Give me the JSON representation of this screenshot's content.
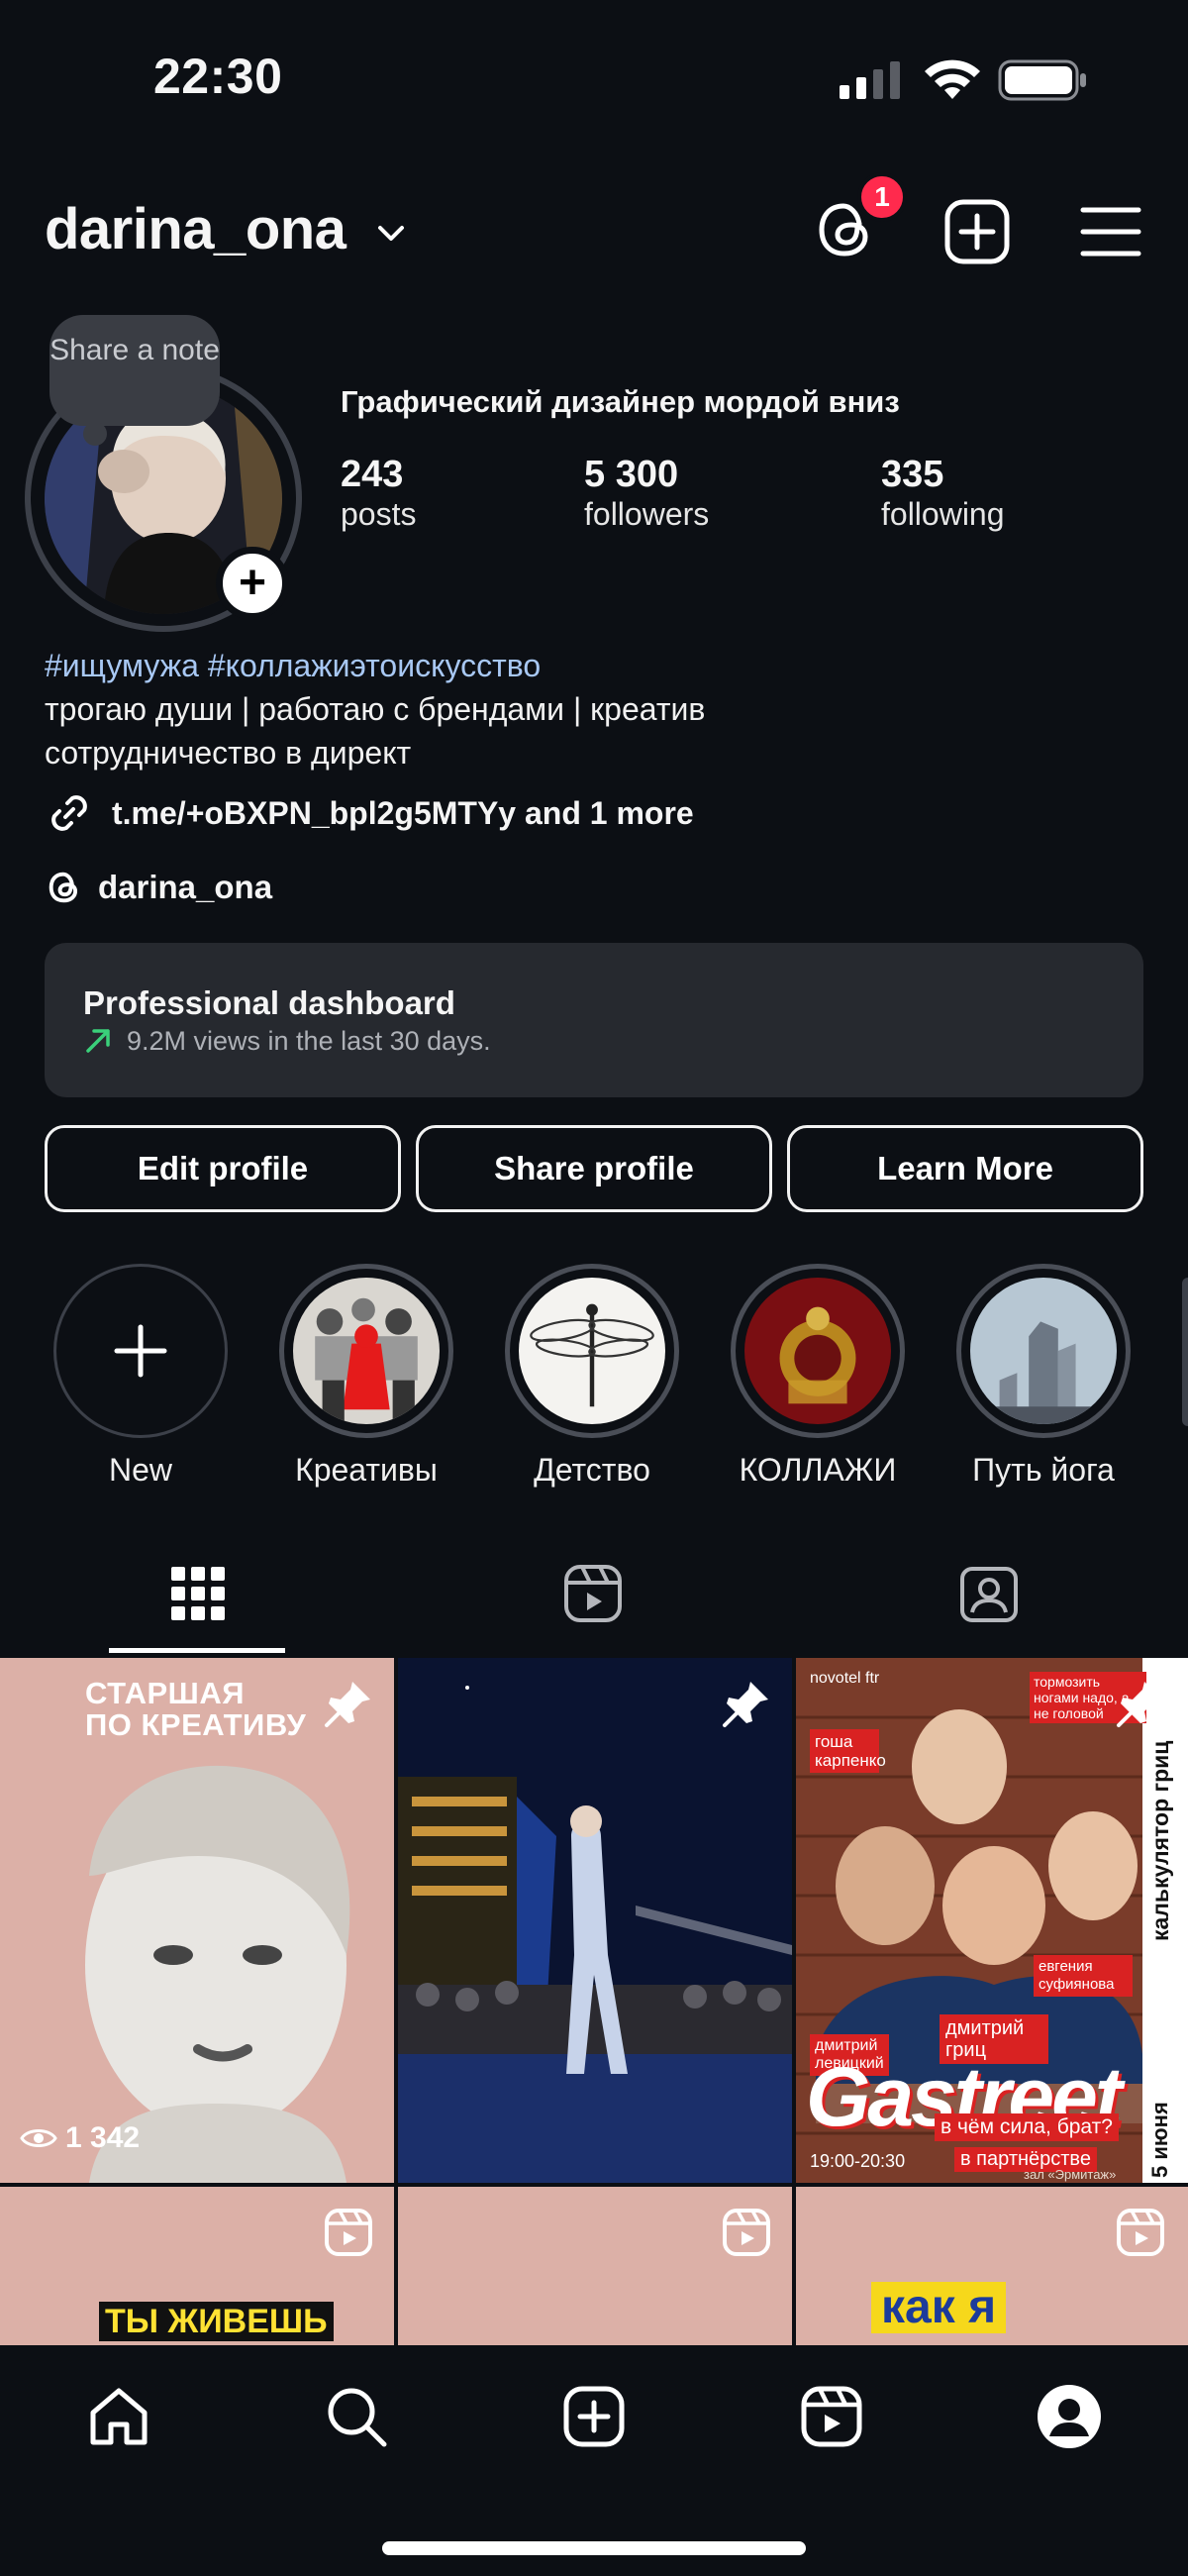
{
  "status": {
    "time": "22:30"
  },
  "header": {
    "username": "darina_ona",
    "notification_count": "1"
  },
  "note": {
    "text": "Share a note"
  },
  "profile": {
    "title": "Графический дизайнер мордой вниз",
    "stats": [
      {
        "value": "243",
        "label": "posts"
      },
      {
        "value": "5 300",
        "label": "followers"
      },
      {
        "value": "335",
        "label": "following"
      }
    ],
    "hashtags": "#ищумужа #коллажиэтоискусство",
    "bio_lines": [
      "трогаю души | работаю с брендами | креатив",
      "сотрудничество в директ"
    ],
    "link": "t.me/+oBXPN_bpl2g5MTYy and 1 more",
    "threads_handle": "darina_ona"
  },
  "dashboard": {
    "title": "Professional dashboard",
    "subtitle": "9.2M views in the last 30 days."
  },
  "buttons": {
    "edit": "Edit profile",
    "share": "Share profile",
    "learn": "Learn More"
  },
  "highlights": [
    {
      "label": "New"
    },
    {
      "label": "Креативы"
    },
    {
      "label": "Детство"
    },
    {
      "label": "КОЛЛАЖИ"
    },
    {
      "label": "Путь йога"
    }
  ],
  "posts": {
    "p1_title": "СТАРШАЯ\nПО КРЕАТИВУ",
    "p1_views": "1 342",
    "p3": {
      "brand": "novotel ftr",
      "names": [
        "гоша карпенко",
        "дмитрий левицкий",
        "дмитрий гриц",
        "евгения суфиянова"
      ],
      "top_note": "тормозить ногами надо, а не головой",
      "side": "калькулятор гриц",
      "title": "Gastreet",
      "sub": "в чём сила, брат?",
      "partner": "в партнёрстве",
      "time": "19:00-20:30",
      "date": "5 июня",
      "venue": "зал «Эрмитаж»"
    },
    "p4_text": "ТЫ ЖИВЕШЬ",
    "p6_text": "как я"
  },
  "colors": {
    "background": "#0c0f14",
    "link": "#a8c8f4",
    "badge": "#ff2a4d",
    "post_pink": "#dcb0a7"
  }
}
